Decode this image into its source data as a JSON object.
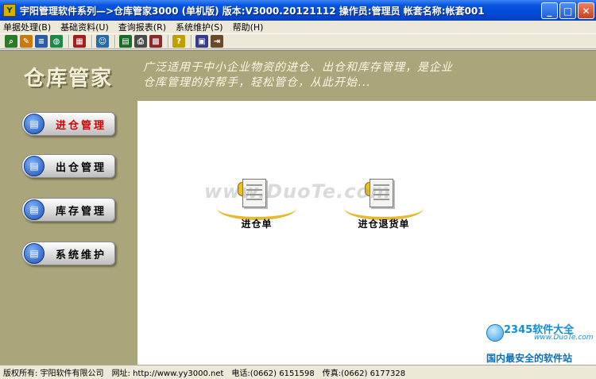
{
  "window": {
    "title": "宇阳管理软件系列—>仓库管家3000 (单机版)   版本:V3000.20121112   操作员:管理员  帐套名称:帐套001"
  },
  "menu": [
    {
      "label": "单据处理(B)"
    },
    {
      "label": "基础资料(U)"
    },
    {
      "label": "查询报表(R)"
    },
    {
      "label": "系统维护(S)"
    },
    {
      "label": "帮助(H)"
    }
  ],
  "toolbar": {
    "buttons": [
      {
        "icon": "find-record-icon",
        "color": "#2a7a2a"
      },
      {
        "icon": "edit-record-icon",
        "color": "#c87a10"
      },
      {
        "icon": "list-icon",
        "color": "#2a5aa8"
      },
      {
        "icon": "globe-icon",
        "color": "#1a8a4a"
      },
      {
        "icon": "calendar-icon",
        "color": "#a02020"
      },
      {
        "icon": "users-icon",
        "color": "#2a6aa8"
      },
      {
        "icon": "spreadsheet-icon",
        "color": "#1a6a2a"
      },
      {
        "icon": "printer-icon",
        "color": "#4a4a4a"
      },
      {
        "icon": "calculator-icon",
        "color": "#8a2a2a"
      },
      {
        "icon": "help-icon",
        "color": "#c0a000"
      },
      {
        "icon": "backup-icon",
        "color": "#3a3a8a"
      },
      {
        "icon": "exit-icon",
        "color": "#6a4a2a"
      }
    ]
  },
  "header": {
    "brand": "仓库管家",
    "slogan_line1": "广泛适用于中小企业物资的进仓、出仓和库存管理，是企业",
    "slogan_line2": "仓库管理的好帮手，轻松管仓，从此开始..."
  },
  "sidebar": {
    "items": [
      {
        "label": "进仓管理",
        "active": true
      },
      {
        "label": "出仓管理",
        "active": false
      },
      {
        "label": "库存管理",
        "active": false
      },
      {
        "label": "系统维护",
        "active": false
      }
    ]
  },
  "workspace": {
    "items": [
      {
        "label": "进仓单"
      },
      {
        "label": "进仓退货单"
      }
    ],
    "watermark": "www.DuoTe.com"
  },
  "corner_logo": {
    "brand": "2345软件大全",
    "url": "www.DuoTe.com",
    "tagline": "国内最安全的软件站"
  },
  "statusbar": {
    "copyright": "版权所有: 宇阳软件有限公司",
    "website": "网址: http://www.yy3000.net",
    "phone": "电话:(0662) 6151598",
    "fax": "传真:(0662) 6177328"
  }
}
